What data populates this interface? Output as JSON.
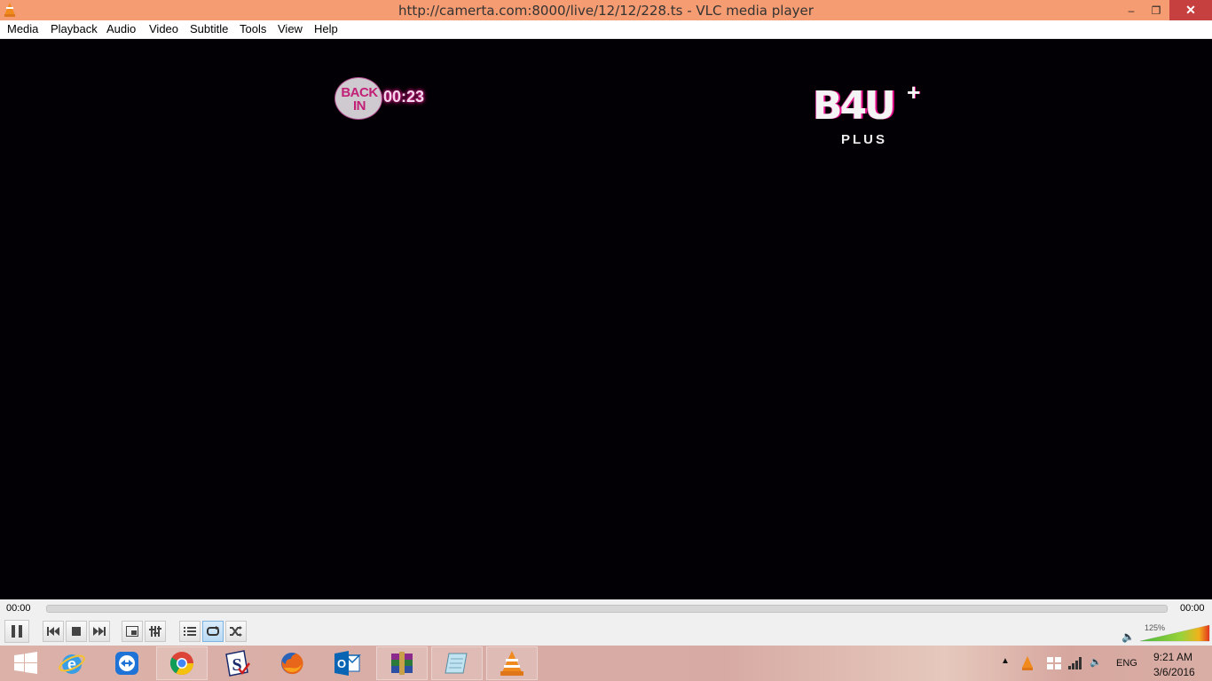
{
  "window": {
    "title": "http://camerta.com:8000/live/12/12/228.ts - VLC media player",
    "minimize": "–",
    "maximize": "❐",
    "close": "✕"
  },
  "menu": [
    "Media",
    "Playback",
    "Audio",
    "Video",
    "Subtitle",
    "Tools",
    "View",
    "Help"
  ],
  "video": {
    "overlay_back_text": "BACK IN",
    "overlay_timer": "00:23",
    "logo_main": "B4U",
    "logo_plus_sign": "+",
    "logo_sub": "PLUS"
  },
  "seek": {
    "elapsed": "00:00",
    "total": "00:00",
    "position": 0
  },
  "controls": {
    "buttons": [
      "pause-icon",
      "previous-icon",
      "stop-icon",
      "next-icon",
      "fullscreen-icon",
      "extended-settings-icon",
      "playlist-icon",
      "loop-icon",
      "shuffle-icon"
    ],
    "volume_percent": "125%",
    "volume_level": 1.25
  },
  "taskbar": {
    "apps": [
      "start-icon",
      "internet-explorer-icon",
      "teamviewer-icon",
      "chrome-icon",
      "scanner-app-icon",
      "firefox-icon",
      "outlook-icon",
      "winrar-icon",
      "notepad-app-icon",
      "vlc-icon"
    ],
    "language": "ENG",
    "time": "9:21 AM",
    "date": "3/6/2016"
  },
  "colors": {
    "titlebar": "#f59c72",
    "close_button": "#c74040",
    "video_background": "#020004",
    "logo_accent": "#e70f8c"
  }
}
